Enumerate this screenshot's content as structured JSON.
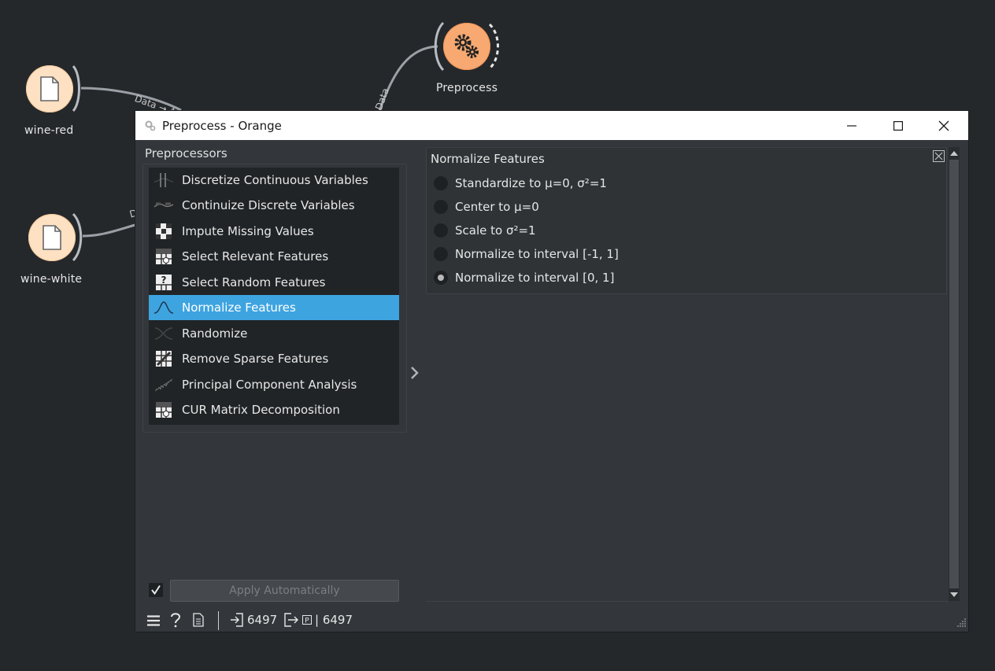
{
  "canvas": {
    "nodes": [
      {
        "label": "wine-red",
        "icon": "document-icon"
      },
      {
        "label": "wine-white",
        "icon": "document-icon"
      },
      {
        "label": "Preprocess",
        "icon": "gears-icon"
      }
    ],
    "links": [
      {
        "label": "Data → Ad"
      },
      {
        "label": "Data"
      },
      {
        "label": "D"
      }
    ]
  },
  "window": {
    "title": "Preprocess - Orange",
    "controls": {
      "minimize": "minimize-icon",
      "maximize": "maximize-icon",
      "close": "close-icon"
    }
  },
  "preprocessors": {
    "title": "Preprocessors",
    "items": [
      {
        "label": "Discretize Continuous Variables",
        "icon": "discretize-icon"
      },
      {
        "label": "Continuize Discrete Variables",
        "icon": "continuize-icon"
      },
      {
        "label": "Impute Missing Values",
        "icon": "impute-icon"
      },
      {
        "label": "Select Relevant Features",
        "icon": "select-relevant-icon"
      },
      {
        "label": "Select Random Features",
        "icon": "select-random-icon"
      },
      {
        "label": "Normalize Features",
        "icon": "normalize-icon",
        "selected": true
      },
      {
        "label": "Randomize",
        "icon": "randomize-icon"
      },
      {
        "label": "Remove Sparse Features",
        "icon": "remove-sparse-icon"
      },
      {
        "label": "Principal Component Analysis",
        "icon": "pca-icon"
      },
      {
        "label": "CUR Matrix Decomposition",
        "icon": "cur-icon"
      }
    ]
  },
  "editor": {
    "title": "Normalize Features",
    "options": [
      {
        "label": "Standardize to μ=0, σ²=1",
        "checked": false
      },
      {
        "label": "Center to μ=0",
        "checked": false
      },
      {
        "label": "Scale to σ²=1",
        "checked": false
      },
      {
        "label": "Normalize to interval [-1, 1]",
        "checked": false
      },
      {
        "label": "Normalize to interval [0, 1]",
        "checked": true
      }
    ]
  },
  "apply": {
    "label": "Apply Automatically",
    "checked": true
  },
  "status": {
    "input_count": "6497",
    "output_text": "| 6497"
  }
}
